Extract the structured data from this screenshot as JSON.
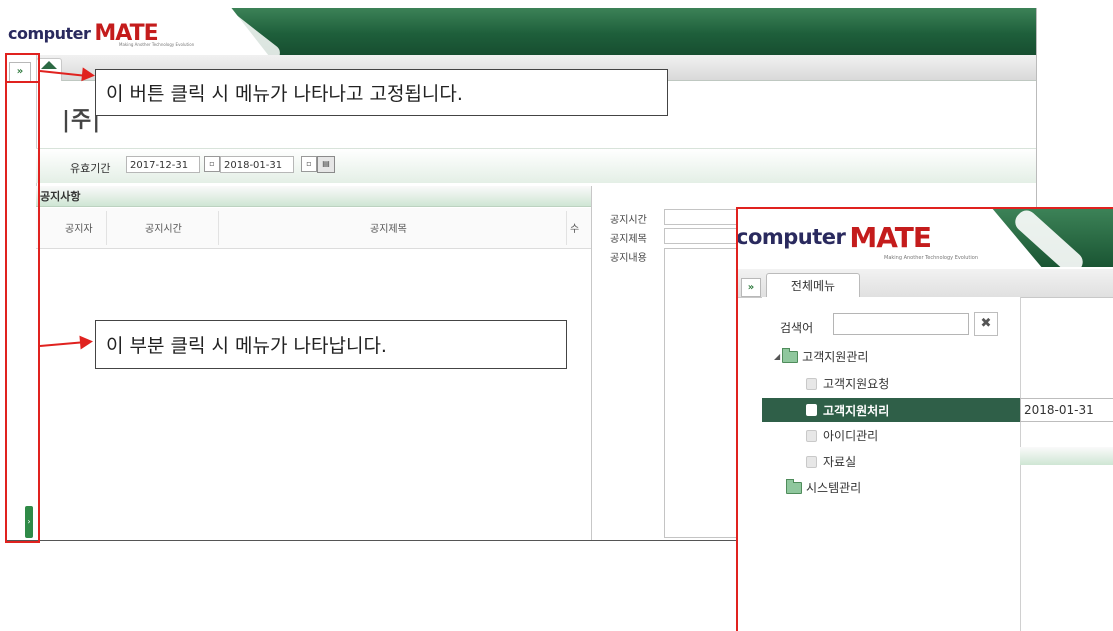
{
  "brand": {
    "logo_text": "computer",
    "logo_accent": "MATE",
    "tagline": "Making Another Technology Evolution",
    "green": "#1e5f3b",
    "accent_red": "#e0221f"
  },
  "main": {
    "expand_label": "»",
    "home_icon": "home-icon",
    "company_title": "|주|",
    "filter": {
      "label": "유효기간",
      "date_from": "2017-12-31",
      "date_to": "2018-01-31"
    },
    "notice_panel": {
      "title": "공지사항",
      "columns": [
        "공지자",
        "공지시간",
        "공지제목",
        "수"
      ]
    },
    "detail_panel": {
      "labels": [
        "공지시간",
        "공지제목",
        "공지내용"
      ]
    }
  },
  "callouts": {
    "button": "이 버튼 클릭 시 메뉴가 나타나고 고정됩니다.",
    "strip": "이 부분 클릭 시 메뉴가 나타납니다."
  },
  "inset": {
    "expand_label": "»",
    "menu_tab": "전체메뉴",
    "search_label": "검색어",
    "search_value": "",
    "clear_label": "✖",
    "tree": {
      "root": "고객지원관리",
      "children": [
        "고객지원요청",
        "고객지원처리",
        "아이디관리",
        "자료실"
      ],
      "selected": "고객지원처리",
      "second_root": "시스템관리"
    },
    "right_date": "2018-01-31"
  }
}
